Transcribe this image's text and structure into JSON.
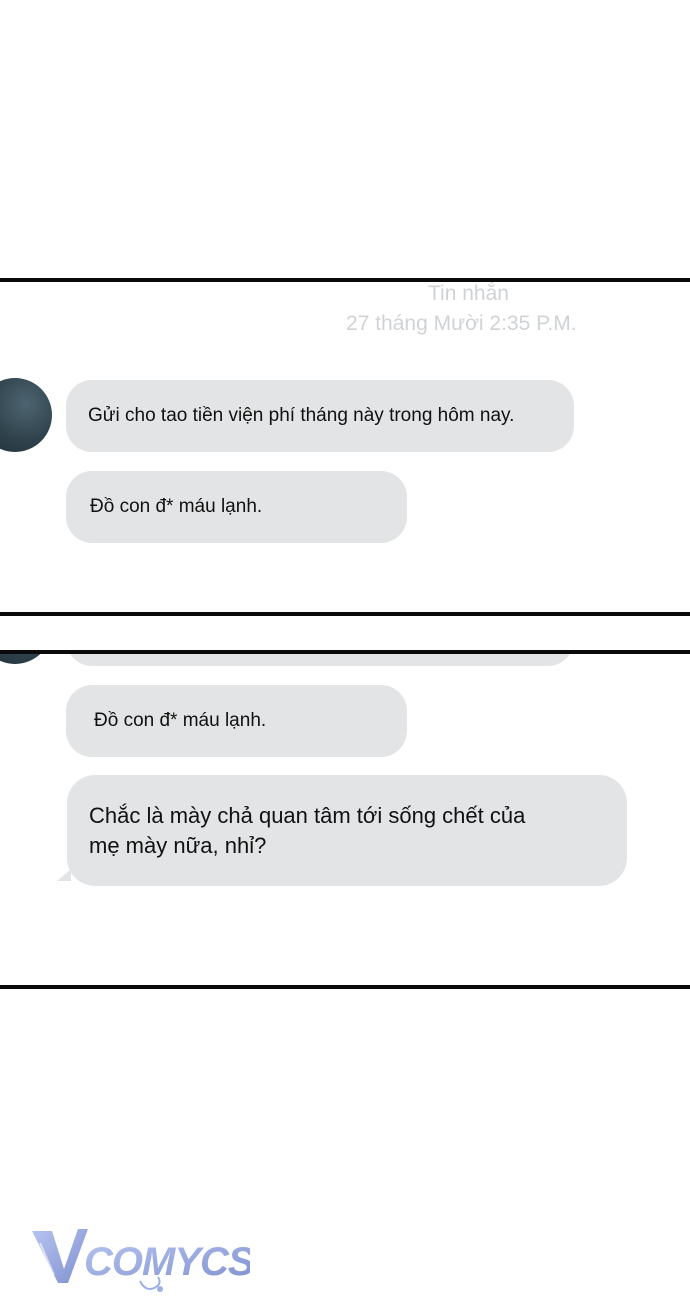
{
  "panel1": {
    "header_title": "Tin nhắn",
    "header_date": "27 tháng Mười 2:35 P.M.",
    "messages": [
      {
        "text": "Gửi cho tao tiền viện phí tháng này trong hôm nay."
      },
      {
        "text": "Đồ con đ* máu lạnh."
      }
    ]
  },
  "panel2": {
    "messages": [
      {
        "text": "Đồ con đ* máu lạnh."
      },
      {
        "text": "Chắc là mày chả quan tâm tới sống chết của mẹ mày nữa, nhỉ?"
      }
    ]
  },
  "watermark": {
    "text": "Vcomycs"
  },
  "colors": {
    "bubble": "#e3e4e5",
    "header_text": "#d0d3d6",
    "border": "#0a0a0a",
    "avatar": "#2f424c",
    "watermark": "#8fa0d8"
  }
}
